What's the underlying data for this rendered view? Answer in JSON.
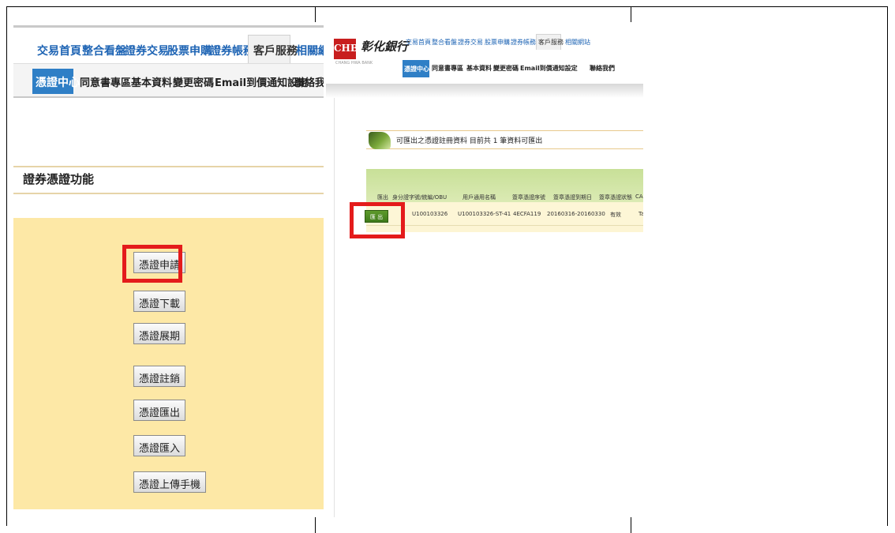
{
  "left": {
    "nav": [
      "交易首頁",
      "整合看盤",
      "證券交易",
      "股票申購",
      "證券帳務"
    ],
    "nav_active": "客戶服務",
    "nav_cut": "相關網站",
    "sub_active": "憑證中心",
    "sub": [
      "同意書專區",
      "基本資料",
      "變更密碼",
      "Email到價通知設定",
      "聯絡我們"
    ],
    "section_title": "證券憑證功能",
    "buttons": [
      "憑證申請",
      "憑證下載",
      "憑證展期",
      "憑證註銷",
      "憑證匯出",
      "憑證匯入",
      "憑證上傳手機"
    ]
  },
  "right": {
    "logo_mark": "CHB",
    "logo_name": "彰化銀行",
    "logo_sub": "CHANG HWA BANK",
    "nav": [
      "交易首頁",
      "整合看盤",
      "證券交易",
      "股票申購",
      "證券帳務"
    ],
    "nav_active": "客戶服務",
    "nav_last": "相關網站",
    "sub_active": "憑證中心",
    "sub": [
      "同意書專區",
      "基本資料",
      "變更密碼",
      "Email到價通知設定",
      "聯絡我們"
    ],
    "info_text": "可匯出之憑證註冊資料 目前共 1 筆資料可匯出",
    "table": {
      "headers": [
        "匯出",
        "身分證字號/統編/OBU",
        "用戶通用名稱",
        "簽章憑證序號",
        "簽章憑證到期日",
        "簽章憑證狀態",
        "CA"
      ],
      "row": {
        "export_button": "匯 出",
        "id": "U100103326",
        "name": "U100103326-ST-41",
        "serial": "4ECFA119",
        "expiry": "20160316-20160330",
        "status": "有效",
        "ca": "Ta"
      }
    }
  }
}
